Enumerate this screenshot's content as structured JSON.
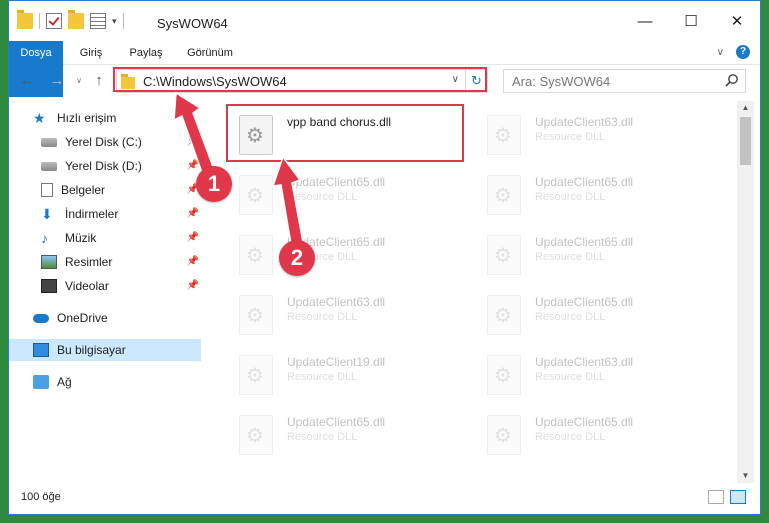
{
  "window": {
    "title": "SysWOW64"
  },
  "ribbon": {
    "tabs": [
      "Dosya",
      "Giriş",
      "Paylaş",
      "Görünüm"
    ]
  },
  "address": {
    "path": "C:\\Windows\\SysWOW64",
    "search_placeholder": "Ara: SysWOW64"
  },
  "sidebar": {
    "items": [
      {
        "label": "Hızlı erişim",
        "icon": "star-icon"
      },
      {
        "label": "Yerel Disk (C:)",
        "icon": "disk-icon",
        "pinned": true
      },
      {
        "label": "Yerel Disk (D:)",
        "icon": "disk-icon",
        "pinned": true
      },
      {
        "label": "Belgeler",
        "icon": "document-icon",
        "pinned": true
      },
      {
        "label": "İndirmeler",
        "icon": "download-icon",
        "pinned": true
      },
      {
        "label": "Müzik",
        "icon": "music-icon",
        "pinned": true
      },
      {
        "label": "Resimler",
        "icon": "pictures-icon",
        "pinned": true
      },
      {
        "label": "Videolar",
        "icon": "videos-icon",
        "pinned": true
      },
      {
        "label": "OneDrive",
        "icon": "cloud-icon"
      },
      {
        "label": "Bu bilgisayar",
        "icon": "computer-icon",
        "selected": true
      },
      {
        "label": "Ağ",
        "icon": "network-icon"
      }
    ]
  },
  "files": [
    {
      "name": "vpp band chorus.dll",
      "type": ""
    },
    {
      "name": "UpdateClient63.dll",
      "type": "Resource DLL"
    },
    {
      "name": "UpdateClient65.dll",
      "type": "Resource DLL"
    },
    {
      "name": "UpdateClient65.dll",
      "type": "Resource DLL"
    },
    {
      "name": "UpdateClient65.dll",
      "type": "Resource DLL"
    },
    {
      "name": "UpdateClient65.dll",
      "type": "Resource DLL"
    },
    {
      "name": "UpdateClient63.dll",
      "type": "Resource DLL"
    },
    {
      "name": "UpdateClient65.dll",
      "type": "Resource DLL"
    },
    {
      "name": "UpdateClient19.dll",
      "type": "Resource DLL"
    },
    {
      "name": "UpdateClient63.dll",
      "type": "Resource DLL"
    },
    {
      "name": "UpdateClient65.dll",
      "type": "Resource DLL"
    },
    {
      "name": "UpdateClient65.dll",
      "type": "Resource DLL"
    }
  ],
  "status": {
    "item_count": "100 öğe"
  },
  "callouts": [
    "1",
    "2"
  ],
  "colors": {
    "accent": "#1979ca",
    "annotation": "#e0374a"
  }
}
